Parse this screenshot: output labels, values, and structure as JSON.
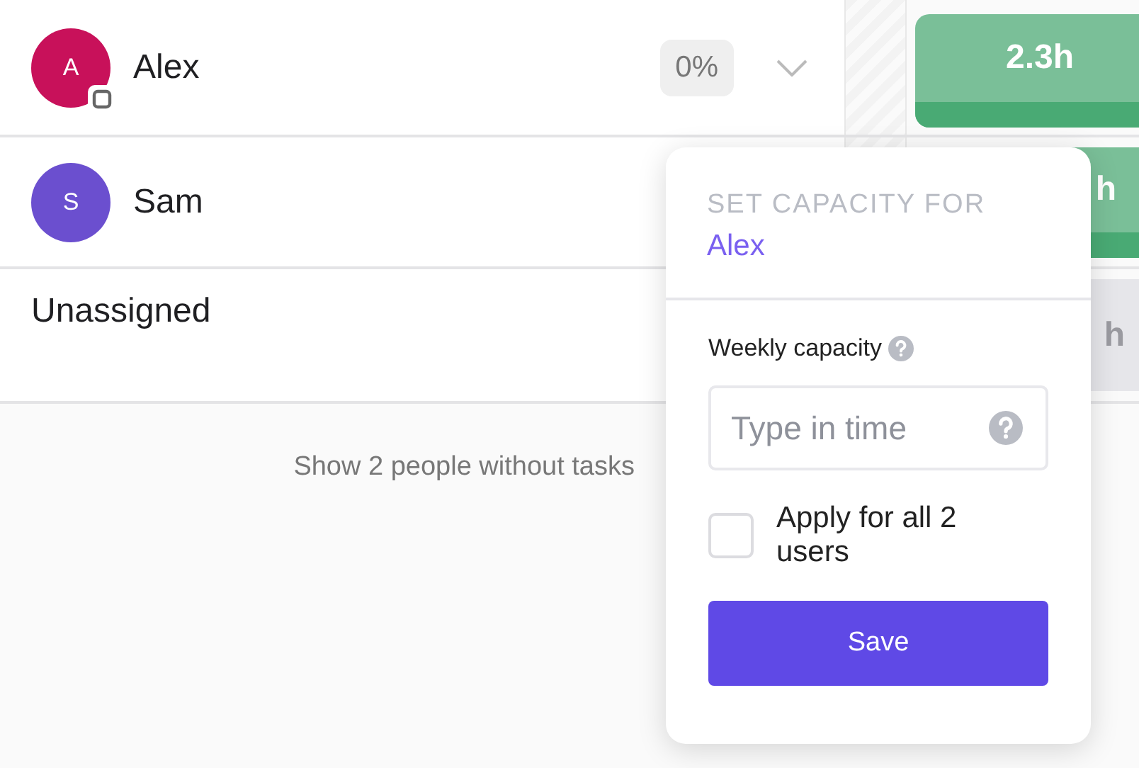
{
  "people": [
    {
      "name": "Alex",
      "initial": "A",
      "color": "#c8115a",
      "badge": true,
      "percent": "0%",
      "bar": {
        "kind": "assigned",
        "text": "2.3h"
      }
    },
    {
      "name": "Sam",
      "initial": "S",
      "color": "#6b4fcf",
      "badge": false,
      "bar": {
        "kind": "assigned",
        "text": "h"
      }
    }
  ],
  "unassigned": {
    "label": "Unassigned",
    "bar": {
      "kind": "unassigned",
      "text": "h"
    }
  },
  "footer_link": "Show 2 people without tasks",
  "popup": {
    "heading": "SET CAPACITY FOR",
    "person": "Alex",
    "field_label": "Weekly capacity",
    "placeholder": "Type in time",
    "checkbox": {
      "label": "Apply for all 2 users",
      "checked": false
    },
    "button": "Save"
  }
}
